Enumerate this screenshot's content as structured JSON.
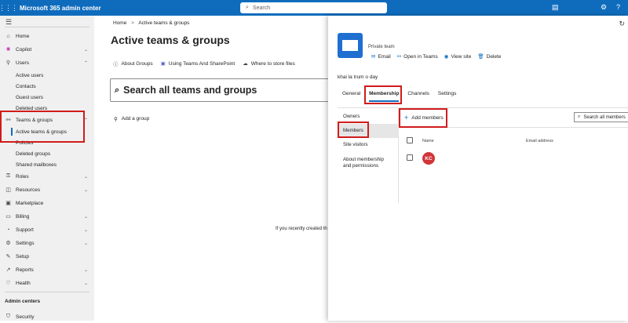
{
  "topbar": {
    "app_title": "Microsoft 365 admin center",
    "search_placeholder": "Search"
  },
  "sidebar": {
    "items": [
      {
        "label": "Home",
        "icon": "home-icon"
      },
      {
        "label": "Copilot",
        "icon": "copilot-icon"
      },
      {
        "label": "Users",
        "icon": "user-icon"
      },
      {
        "label": "Active users"
      },
      {
        "label": "Contacts"
      },
      {
        "label": "Guest users"
      },
      {
        "label": "Deleted users"
      },
      {
        "label": "Teams & groups",
        "icon": "teams-groups-icon"
      },
      {
        "label": "Active teams & groups"
      },
      {
        "label": "Policies"
      },
      {
        "label": "Deleted groups"
      },
      {
        "label": "Shared mailboxes"
      },
      {
        "label": "Roles",
        "icon": "roles-icon"
      },
      {
        "label": "Resources",
        "icon": "resources-icon"
      },
      {
        "label": "Marketplace",
        "icon": "marketplace-icon"
      },
      {
        "label": "Billing",
        "icon": "billing-icon"
      },
      {
        "label": "Support",
        "icon": "support-icon"
      },
      {
        "label": "Settings",
        "icon": "settings-icon"
      },
      {
        "label": "Setup",
        "icon": "setup-icon"
      },
      {
        "label": "Reports",
        "icon": "reports-icon"
      },
      {
        "label": "Health",
        "icon": "health-icon"
      }
    ],
    "section_header": "Admin centers",
    "security_label": "Security"
  },
  "main": {
    "breadcrumb_home": "Home",
    "breadcrumb_sep": ">",
    "breadcrumb_current": "Active teams & groups",
    "title": "Active teams & groups",
    "links": [
      "About Groups",
      "Using Teams And SharePoint",
      "Where to store files"
    ],
    "search_placeholder": "Search all teams and groups",
    "add_group": "Add a group",
    "hint": "If you recently created th"
  },
  "panel": {
    "type_label": "Private team",
    "actions": [
      "Email",
      "Open in Teams",
      "View site",
      "Delete"
    ],
    "group_name": "khai la trum o day",
    "tabs": [
      "General",
      "Membership",
      "Channels",
      "Settings"
    ],
    "left_items": [
      "Owners",
      "Members",
      "Site visitors",
      "About membership and permissions"
    ],
    "add_members": "Add members",
    "search_members": "Search all members",
    "col_name": "Name",
    "col_email": "Email address",
    "member_initials": "KC"
  },
  "colors": {
    "brand": "#0f6cbd",
    "highlight": "#d11b1b",
    "avatar": "#d13438"
  }
}
